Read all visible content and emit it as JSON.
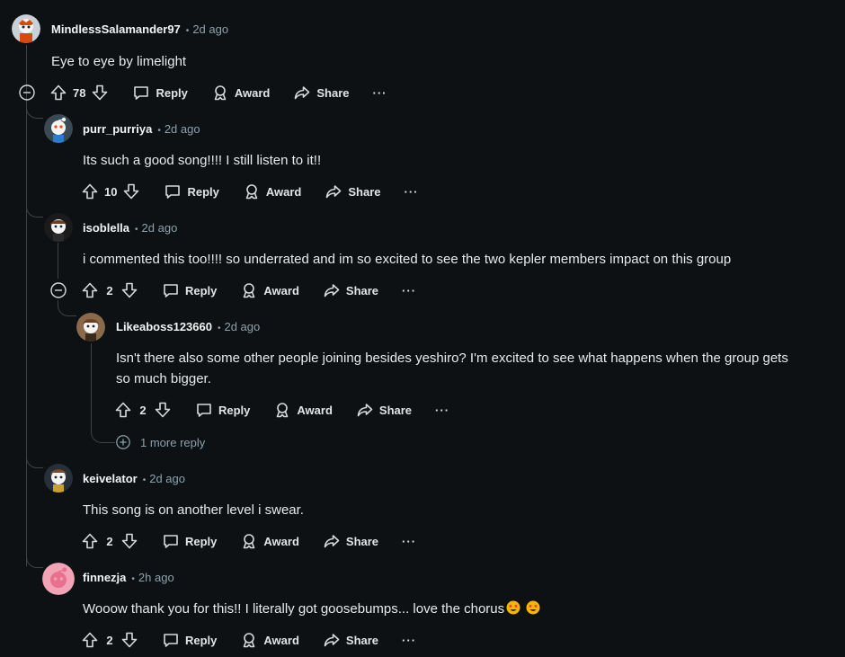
{
  "comments": [
    {
      "user": "MindlessSalamander97",
      "time": "2d ago",
      "text": "Eye to eye by limelight",
      "score": "78"
    },
    {
      "user": "purr_purriya",
      "time": "2d ago",
      "text": "Its such a good song!!!! I still listen to it!!",
      "score": "10"
    },
    {
      "user": "isoblella",
      "time": "2d ago",
      "text": "i commented this too!!!! so underrated and im so excited to see the two kepler members impact on this group",
      "score": "2"
    },
    {
      "user": "Likeaboss123660",
      "time": "2d ago",
      "text_line1": "Isn't there also some other people joining besides yeshiro? I'm excited to see what happens when the group gets",
      "text_line2": "so much bigger.",
      "score": "2"
    },
    {
      "user": "keivelator",
      "time": "2d ago",
      "text": "This song is on another level i swear.",
      "score": "2"
    },
    {
      "user": "finnezja",
      "time": "2h ago",
      "text": "Wooow thank you for this!! I literally got goosebumps... love the chorus",
      "score": "2"
    }
  ],
  "actions": {
    "reply": "Reply",
    "award": "Award",
    "share": "Share",
    "more": "···"
  },
  "more_replies": "1 more reply",
  "separator": "•"
}
